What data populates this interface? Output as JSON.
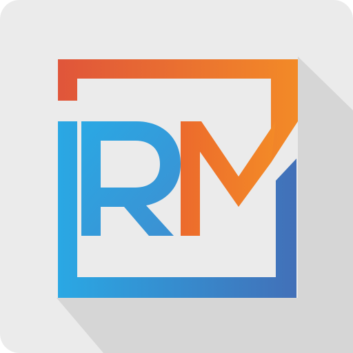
{
  "logo": {
    "monogram": "RM",
    "icon": "rm-monogram-app-icon",
    "colors": {
      "background": "#ebebeb",
      "orange_dark": "#e0553a",
      "orange": "#ec6a2c",
      "orange_light": "#f38a27",
      "blue_light": "#2aa8e4",
      "blue": "#3d8fd1",
      "blue_dark": "#4270b8",
      "shadow": "#d6d6d6"
    }
  }
}
